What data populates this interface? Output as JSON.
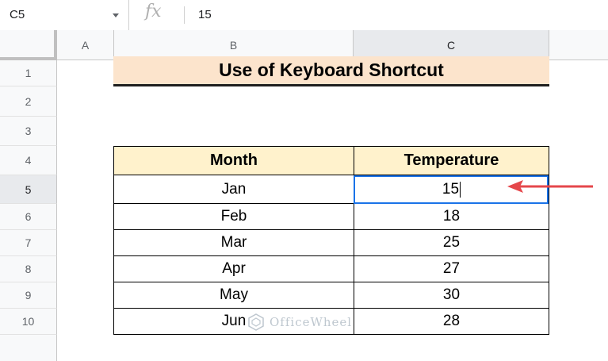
{
  "formula_bar": {
    "name_box": "C5",
    "fx_label": "fx",
    "value": "15"
  },
  "columns": [
    "A",
    "B",
    "C"
  ],
  "selected_column": "C",
  "rows": [
    "1",
    "2",
    "3",
    "4",
    "5",
    "6",
    "7",
    "8",
    "9",
    "10"
  ],
  "selected_row": "5",
  "title": "Use of Keyboard Shortcut",
  "table": {
    "headers": [
      "Month",
      "Temperature"
    ],
    "rows": [
      [
        "Jan",
        "15"
      ],
      [
        "Feb",
        "18"
      ],
      [
        "Mar",
        "25"
      ],
      [
        "Apr",
        "27"
      ],
      [
        "May",
        "30"
      ],
      [
        "Jun",
        "28"
      ]
    ]
  },
  "watermark": "OfficeWheel",
  "colors": {
    "title_fill": "#fce4cc",
    "header_fill": "#fff2cc",
    "selection": "#1a73e8",
    "arrow": "#e5474b"
  },
  "icons": {
    "name_box_dropdown": "caret-down-icon",
    "annotation": "arrow-left-icon"
  }
}
